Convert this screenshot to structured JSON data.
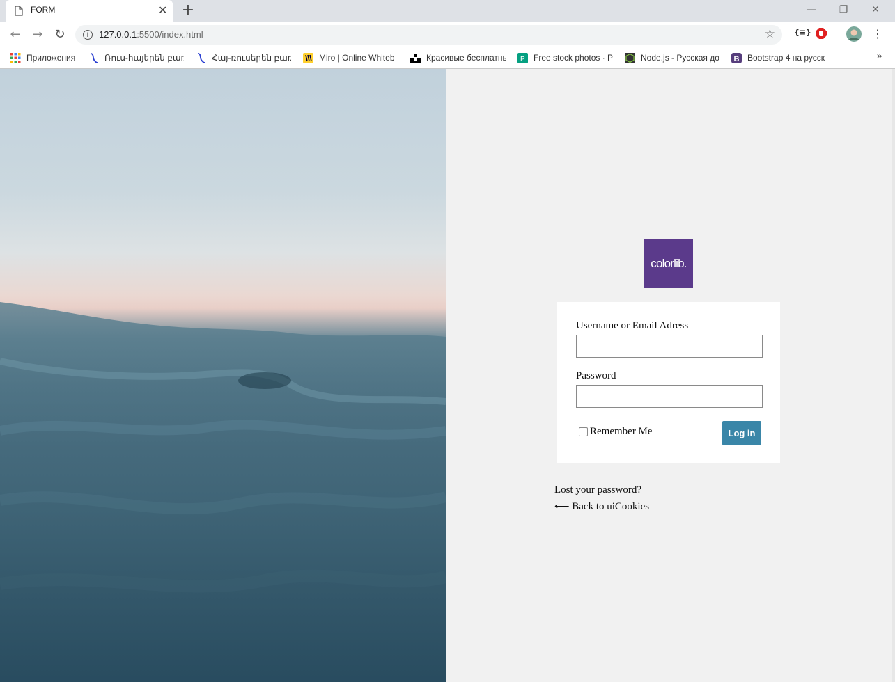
{
  "browser": {
    "tab_title": "FORM",
    "tab_close": "✕",
    "new_tab": "+",
    "url_host": "127.0.0.1",
    "url_path": ":5500/index.html",
    "info_glyph": "i",
    "star_glyph": "☆",
    "back_glyph": "←",
    "forward_glyph": "→",
    "reload_glyph": "↻",
    "minimize_glyph": "—",
    "restore_glyph": "❐",
    "close_glyph": "✕",
    "ext_json_label": "{≡}",
    "menu_glyph": "⋮",
    "more_glyph": "»"
  },
  "bookmarks": [
    {
      "label": "Приложения",
      "icon": "apps-grid-icon"
    },
    {
      "label": "Ռուս-հայերեն բառա",
      "icon": "dictionary-icon"
    },
    {
      "label": "Հայ-ռուսերեն բառա",
      "icon": "dictionary-icon"
    },
    {
      "label": "Miro | Online Whiteb",
      "icon": "miro-icon",
      "color": "#ffd02f"
    },
    {
      "label": "Красивые бесплатны",
      "icon": "unsplash-icon"
    },
    {
      "label": "Free stock photos · Pe",
      "icon": "pexels-icon",
      "color": "#05a081"
    },
    {
      "label": "Node.js - Русская док",
      "icon": "nodejs-icon",
      "color": "#3c873a"
    },
    {
      "label": "Bootstrap 4 на русск",
      "icon": "bootstrap-icon",
      "color": "#563d7c"
    }
  ],
  "page": {
    "logo_text": "colorlib.",
    "username_label": "Username or Email Adress",
    "password_label": "Password",
    "remember_label": "Remember Me",
    "login_button": "Log in",
    "lost_password": "Lost your password?",
    "back_link": "⟵  Back to uiCookies",
    "colors": {
      "logo_bg": "#5b3a8b",
      "button_bg": "#3a86a8",
      "right_bg": "#f1f1f1"
    }
  }
}
